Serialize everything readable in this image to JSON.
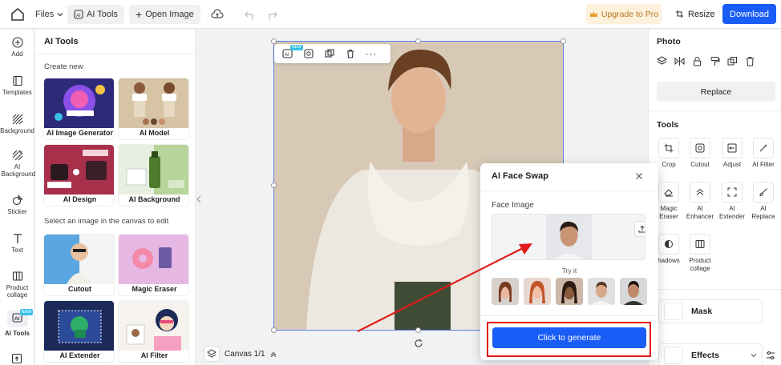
{
  "topbar": {
    "files_label": "Files",
    "ai_tools_label": "AI Tools",
    "open_image_label": "Open Image",
    "upgrade_label": "Upgrade to Pro",
    "resize_label": "Resize",
    "download_label": "Download"
  },
  "rail": {
    "items": [
      {
        "label": "Add",
        "icon": "plus-circle-icon"
      },
      {
        "label": "Templates",
        "icon": "templates-icon"
      },
      {
        "label": "Background",
        "icon": "background-icon"
      },
      {
        "label": "AI Background",
        "icon": "ai-background-icon"
      },
      {
        "label": "Sticker",
        "icon": "sticker-icon"
      },
      {
        "label": "Text",
        "icon": "text-icon"
      },
      {
        "label": "Product collage",
        "icon": "collage-icon"
      },
      {
        "label": "AI Tools",
        "icon": "ai-tools-icon",
        "badge": "NEW"
      }
    ]
  },
  "panel": {
    "title": "AI Tools",
    "create_new": "Create new",
    "select_label": "Select an image in the canvas to edit",
    "tiles_create": [
      "AI Image Generator",
      "AI Model",
      "AI Design",
      "AI Background"
    ],
    "tiles_edit": [
      "Cutout",
      "Magic Eraser",
      "AI Extender",
      "AI Filter"
    ]
  },
  "canvas": {
    "footer_label": "Canvas 1/1",
    "float_badge": "NEW"
  },
  "right_panel": {
    "photo_title": "Photo",
    "replace_label": "Replace",
    "tools_title": "Tools",
    "tools": [
      "Crop",
      "Cutout",
      "Adjust",
      "AI Filter",
      "Magic Eraser",
      "AI Enhancer",
      "AI Extender",
      "AI Replace",
      "hadows",
      "Product collage"
    ],
    "mask_label": "Mask",
    "effects_label": "Effects"
  },
  "dialog": {
    "title": "AI Face Swap",
    "face_label": "Face Image",
    "try_it": "Try it",
    "generate_label": "Click to generate"
  },
  "colors": {
    "accent": "#1a5cf6",
    "highlight": "#e21b1b",
    "upgrade_bg": "#fdf1dc",
    "upgrade_text": "#b6741d"
  }
}
